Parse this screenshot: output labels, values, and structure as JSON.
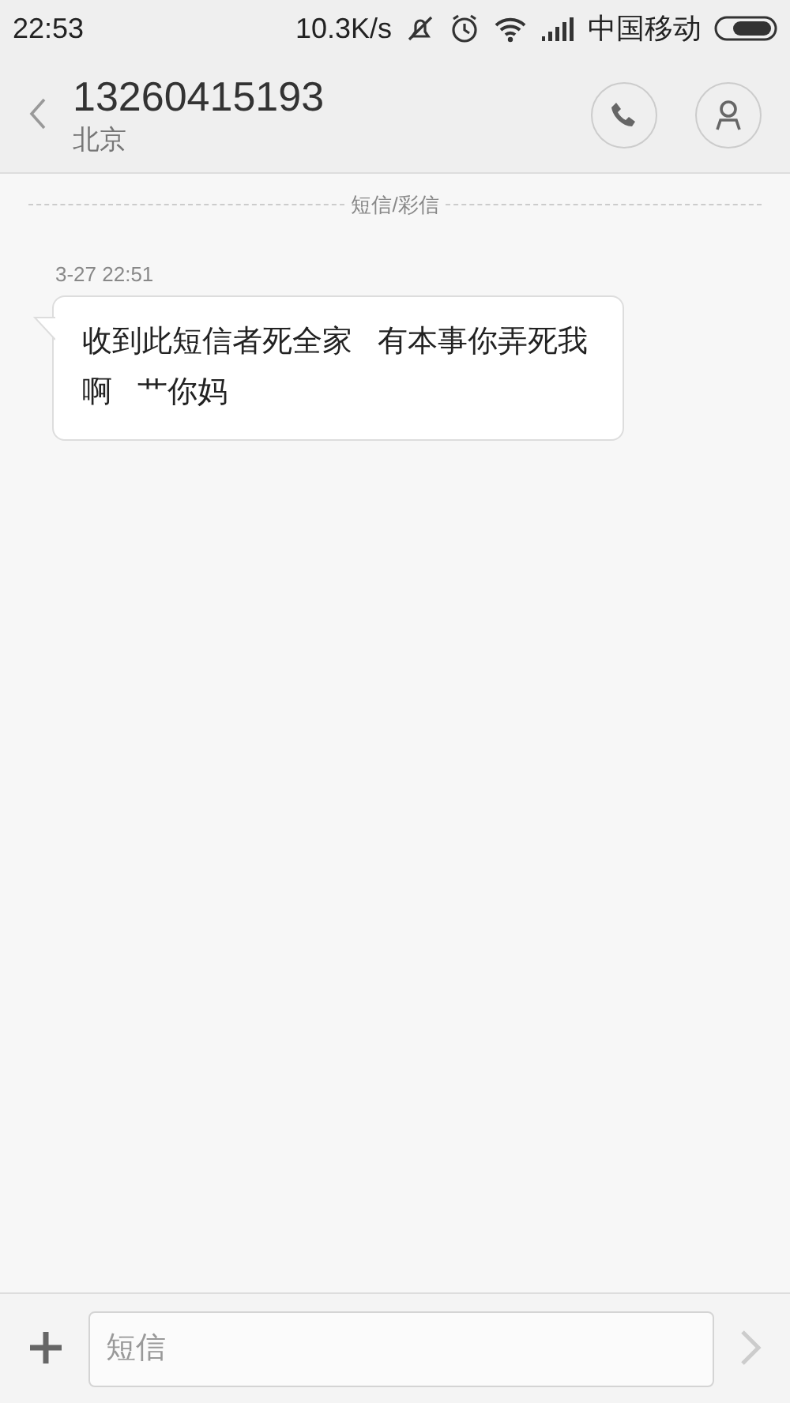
{
  "status_bar": {
    "time": "22:53",
    "speed": "10.3K/s",
    "carrier": "中国移动"
  },
  "header": {
    "number": "13260415193",
    "location": "北京"
  },
  "divider": "短信/彩信",
  "messages": [
    {
      "timestamp": "3-27 22:51",
      "text": "收到此短信者死全家   有本事你弄死我啊   艹你妈"
    }
  ],
  "composer": {
    "placeholder": "短信"
  }
}
